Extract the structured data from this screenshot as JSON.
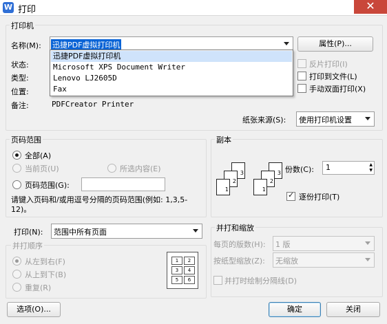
{
  "window": {
    "title": "打印",
    "app_icon_glyph": "W",
    "close_glyph": "✕"
  },
  "printer": {
    "group_label": "打印机",
    "name_label": "名称(M):",
    "selected": "迅捷PDF虚拟打印机",
    "properties_button": "属性(P)...",
    "status_label": "状态:",
    "type_label": "类型:",
    "location_label": "位置:",
    "comment_label": "备注:",
    "comment_value": "PDFCreator Printer",
    "options": [
      "迅捷PDF虚拟打印机",
      "Microsoft XPS Document Writer",
      "Lenovo LJ2605D",
      "Fax"
    ],
    "reverse_print": "反片打印(I)",
    "print_to_file": "打印到文件(L)",
    "manual_duplex": "手动双面打印(X)",
    "paper_source_label": "纸张来源(S):",
    "paper_source_value": "使用打印机设置"
  },
  "page_range": {
    "group_label": "页码范围",
    "all": "全部(A)",
    "current_page": "当前页(U)",
    "selection": "所选内容(E)",
    "pages": "页码范围(G):",
    "pages_value": "",
    "hint": "请键入页码和/或用逗号分隔的页码范围(例如: 1,3,5-12)。"
  },
  "copies": {
    "group_label": "副本",
    "count_label": "份数(C):",
    "count_value": "1",
    "collate": "逐份打印(T)",
    "collate_checked": true,
    "sheet_numbers": [
      "1",
      "2",
      "3"
    ]
  },
  "print_what": {
    "label": "打印(N):",
    "value": "范围中所有页面",
    "order_group_label": "并打顺序",
    "left_to_right": "从左到右(F)",
    "top_to_bottom": "从上到下(B)",
    "repeat": "重复(R)",
    "grid_numbers": [
      "1",
      "2",
      "3",
      "4",
      "5",
      "6"
    ]
  },
  "zoom": {
    "group_label": "并打和缩放",
    "pages_per_sheet_label": "每页的版数(H):",
    "pages_per_sheet_value": "1 版",
    "scale_label": "按纸型缩放(Z):",
    "scale_value": "无缩放",
    "draw_borders": "并打时绘制分隔线(D)"
  },
  "footer": {
    "options_button": "选项(O)...",
    "ok_button": "确定",
    "close_button": "关闭"
  },
  "colors": {
    "accent": "#0a64d6",
    "close": "#c9473a",
    "highlight": "#cfe3fb"
  }
}
